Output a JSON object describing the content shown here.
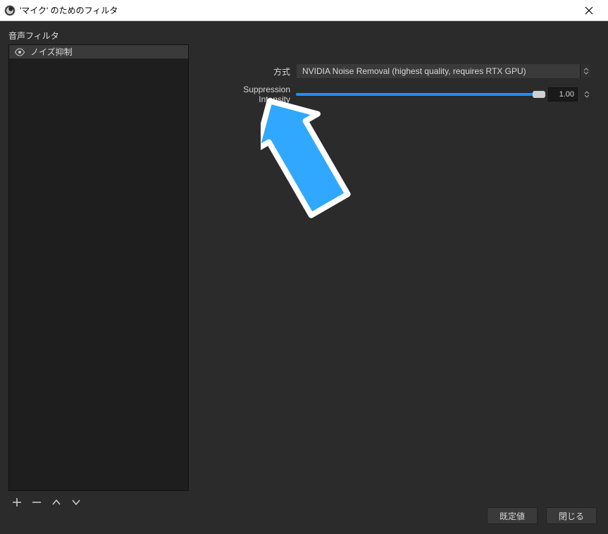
{
  "window": {
    "title": "'マイク' のためのフィルタ"
  },
  "sidebar": {
    "section_label": "音声フィルタ",
    "items": [
      {
        "label": "ノイズ抑制"
      }
    ]
  },
  "form": {
    "method_label": "方式",
    "method_value": "NVIDIA Noise Removal (highest quality, requires RTX GPU)",
    "intensity_label": "Suppression Intensity",
    "intensity_value": "1.00"
  },
  "buttons": {
    "defaults": "既定値",
    "close": "閉じる"
  }
}
